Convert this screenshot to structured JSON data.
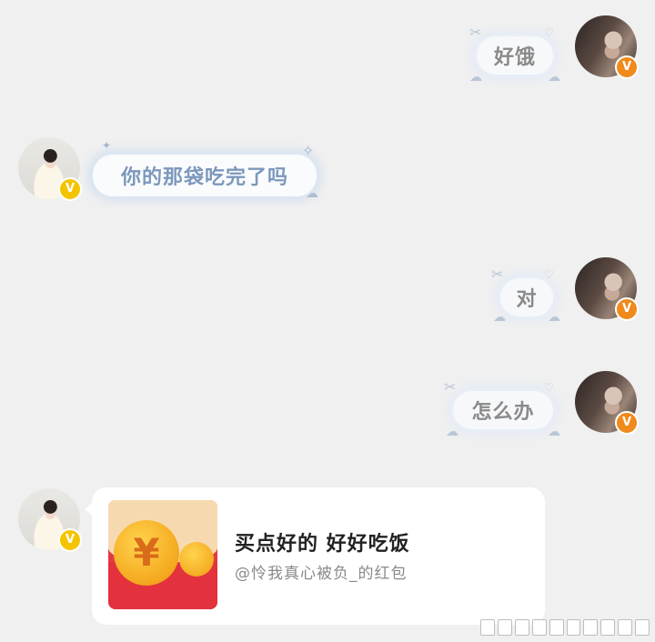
{
  "messages": [
    {
      "id": "m1",
      "side": "right",
      "text": "好饿"
    },
    {
      "id": "m2",
      "side": "left",
      "text": "你的那袋吃完了吗"
    },
    {
      "id": "m3",
      "side": "right",
      "text": "对"
    },
    {
      "id": "m4",
      "side": "right",
      "text": "怎么办"
    }
  ],
  "red_packet": {
    "title": "买点好的 好好吃饭",
    "subtitle": "@怜我真心被负_的红包",
    "currency_symbol": "¥"
  },
  "badges": {
    "verified_symbol": "V",
    "right_color": "#f08a1c",
    "left_color": "#f5c400"
  },
  "icons": {
    "bubble_decoration": "bow-ribbon-icon",
    "cloud_decoration": "cloud-icon",
    "sparkle_decoration": "sparkle-icon"
  }
}
